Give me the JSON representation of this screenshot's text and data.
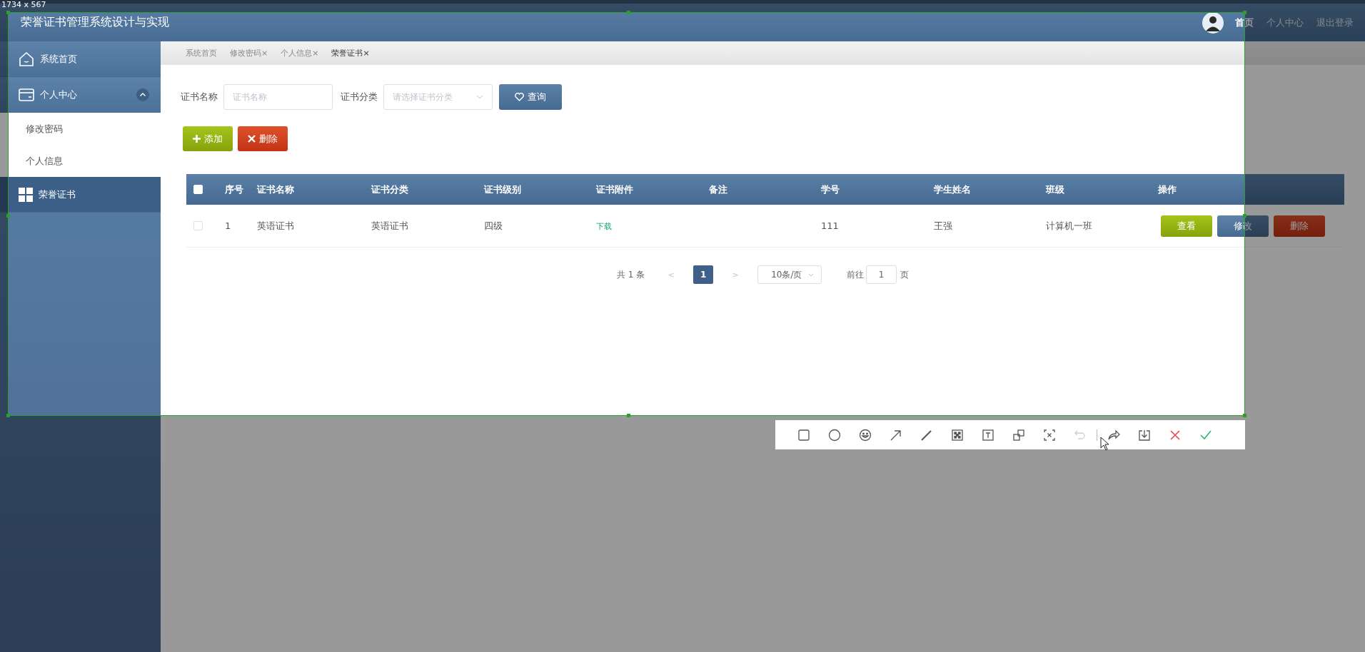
{
  "capture": {
    "size_label": "1734 x 567",
    "toolbar": {
      "undo_disabled": true
    }
  },
  "header": {
    "title": "荣誉证书管理系统设计与实现",
    "nav": [
      {
        "label": "首页",
        "selected": true
      },
      {
        "label": "个人中心",
        "selected": false
      },
      {
        "label": "退出登录",
        "selected": false
      }
    ]
  },
  "sidebar": {
    "items": [
      {
        "label": "系统首页",
        "selected": false
      },
      {
        "label": "个人中心",
        "selected": false,
        "expanded": true,
        "children": [
          {
            "label": "修改密码",
            "selected": false
          },
          {
            "label": "个人信息",
            "selected": false
          }
        ]
      },
      {
        "label": "荣誉证书",
        "selected": true
      }
    ]
  },
  "tabs": [
    {
      "label": "系统首页",
      "selected": false
    },
    {
      "label": "修改密码",
      "close": "×",
      "selected": false
    },
    {
      "label": "个人信息",
      "close": "×",
      "selected": false
    },
    {
      "label": "荣誉证书",
      "close": "×",
      "selected": true
    }
  ],
  "search": {
    "fields": [
      {
        "label": "证书名称",
        "placeholder": "证书名称",
        "kind": "input"
      },
      {
        "label": "证书分类",
        "placeholder": "请选择证书分类",
        "kind": "select"
      }
    ],
    "button": "查询"
  },
  "actions": [
    {
      "label": "添加",
      "kind": "add"
    },
    {
      "label": "删除",
      "kind": "delete"
    }
  ],
  "table": {
    "all_checked": false,
    "columns": [
      "序号",
      "证书名称",
      "证书分类",
      "证书级别",
      "证书附件",
      "备注",
      "学号",
      "学生姓名",
      "班级",
      "操作"
    ],
    "rows": [
      {
        "checked": false,
        "cells": [
          "1",
          "英语证书",
          "英语证书",
          "四级"
        ],
        "attachment": "下载",
        "cells_after": [
          "111",
          "王强",
          "计算机一班"
        ],
        "buttons": [
          {
            "label": "查看",
            "kind": "view"
          },
          {
            "label": "修改",
            "kind": "edit"
          },
          {
            "label": "删除",
            "kind": "delete"
          }
        ]
      }
    ]
  },
  "pagination": {
    "total": "共 1 条",
    "prev": "<",
    "pages": [
      {
        "label": "1",
        "selected": true
      }
    ],
    "next": ">",
    "page_size": "10条/页",
    "goto_label": "前往",
    "goto_value": "1",
    "goto_suffix": "页"
  }
}
